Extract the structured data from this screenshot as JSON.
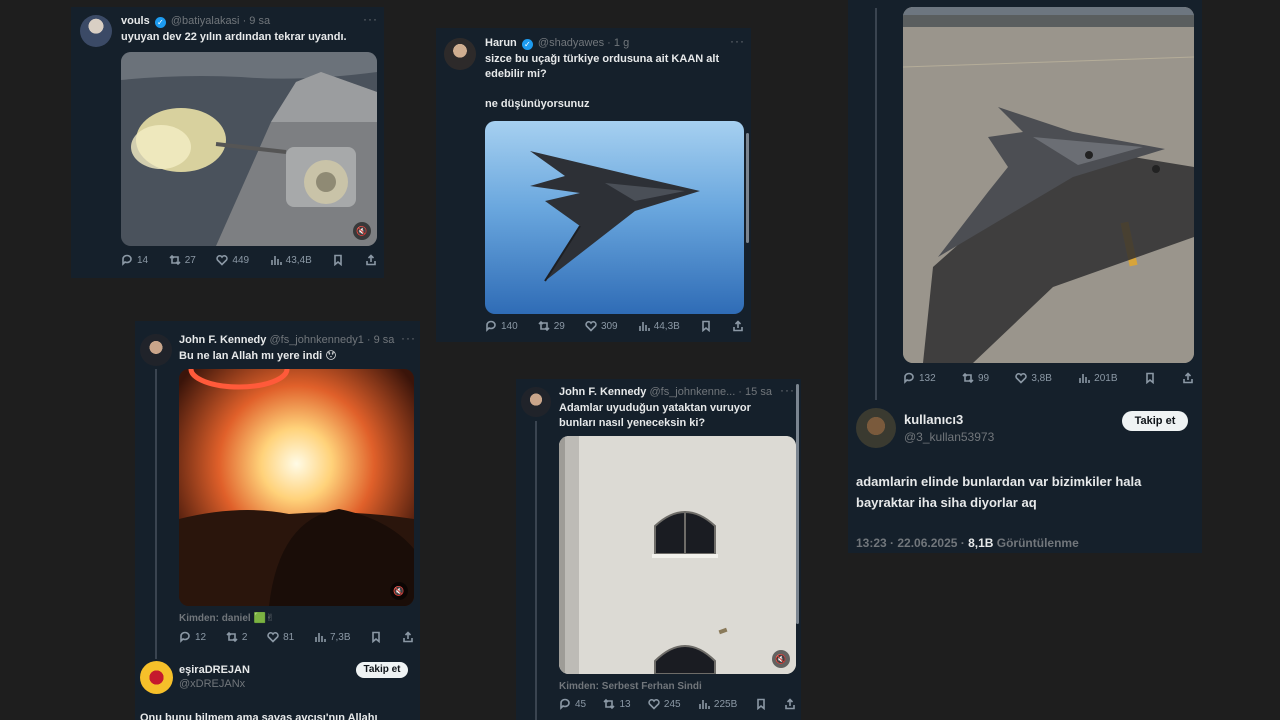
{
  "tweets": {
    "vouls": {
      "name": "vouls",
      "handle": "@batiyalakasi",
      "time": "9 sa",
      "more": "···",
      "text": "uyuyan dev 22 yılın ardından tekrar uyandı.",
      "replies": "14",
      "retweets": "27",
      "likes": "449",
      "views": "43,4B"
    },
    "harun": {
      "name": "Harun",
      "handle": "@shadyawes",
      "time": "1 g",
      "more": "···",
      "text": "sizce bu uçağı türkiye ordusuna ait KAAN alt edebilir mi?\n\nne düşünüyorsunuz",
      "replies": "140",
      "retweets": "29",
      "likes": "309",
      "views": "44,3B"
    },
    "jfk1": {
      "name": "John F. Kennedy",
      "handle": "@fs_johnkennedy1",
      "time": "9 sa",
      "more": "···",
      "text": "Bu ne lan Allah mı yere indi 😯",
      "from": "Kimden: daniel 🟩✌",
      "replies": "12",
      "retweets": "2",
      "likes": "81",
      "views": "7,3B"
    },
    "jfk2": {
      "name": "John F. Kennedy",
      "handle": "@fs_johnkenne...",
      "time": "15 sa",
      "more": "···",
      "text": "Adamlar uyuduğun yataktan vuruyor bunları nasıl yeneceksin ki?",
      "from": "Kimden: Serbest Ferhan Sindi",
      "replies": "45",
      "retweets": "13",
      "likes": "245",
      "views": "225B"
    },
    "b2": {
      "replies": "132",
      "retweets": "99",
      "likes": "3,8B",
      "views": "201B"
    },
    "kullanici": {
      "name": "kullanıcı3",
      "handle": "@3_kullan53973",
      "follow": "Takip et",
      "text": "adamlarin elinde bunlardan var bizimkiler hala bayraktar iha siha diyorlar aq",
      "timestamp": "13:23 · 22.06.2025 · ",
      "views_count": "8,1B",
      "views_label": " Görüntülenme"
    },
    "esira": {
      "name": "eşiraDREJAN",
      "handle": "@xDREJANx",
      "follow": "Takip et",
      "text": "Onu bunu bilmem ama savaş avcısı'nın Allahı"
    }
  },
  "icons": {
    "reply": "reply-icon",
    "retweet": "retweet-icon",
    "like": "heart-icon",
    "views": "views-icon",
    "bookmark": "bookmark-icon",
    "share": "share-icon"
  },
  "colors": {
    "card_bg": "#15202b",
    "page_bg": "#1e1e1e",
    "verified": "#1d9bf0"
  }
}
